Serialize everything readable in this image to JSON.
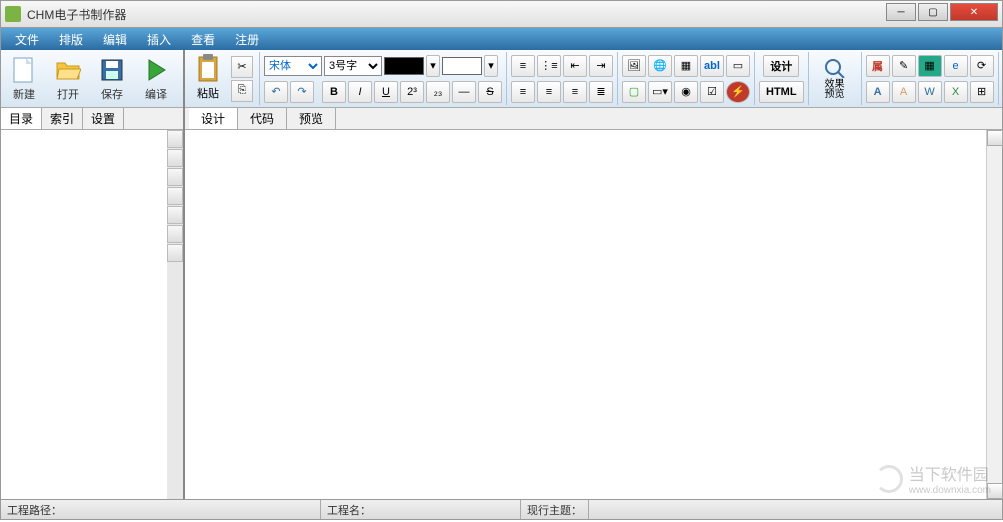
{
  "window": {
    "title": "CHM电子书制作器"
  },
  "menu": {
    "items": [
      "文件",
      "排版",
      "编辑",
      "插入",
      "查看",
      "注册"
    ]
  },
  "left_toolbar": {
    "new": "新建",
    "open": "打开",
    "save": "保存",
    "compile": "编译"
  },
  "left_tabs": {
    "items": [
      "目录",
      "索引",
      "设置"
    ],
    "active": 0
  },
  "right_tabs": {
    "items": [
      "设计",
      "代码",
      "预览"
    ],
    "active": 0
  },
  "paste": {
    "label": "粘贴"
  },
  "font_select": {
    "value": "宋体"
  },
  "size_select": {
    "value": "3号字"
  },
  "design_label": "设计",
  "preview_label_top": "效果",
  "preview_label_bottom": "预览",
  "html_label": "HTML",
  "prop_label": "属",
  "sup_label": "2³",
  "sub_label": "₂₃",
  "bold": "B",
  "italic": "I",
  "underline": "U",
  "strike": "S",
  "colors": {
    "fg": "#000000",
    "bg": "#ffffff"
  },
  "status": {
    "path": "工程路径：",
    "name": "工程名：",
    "theme": "现行主题："
  },
  "watermark": {
    "text": "当下软件园",
    "url": "www.downxia.com"
  }
}
